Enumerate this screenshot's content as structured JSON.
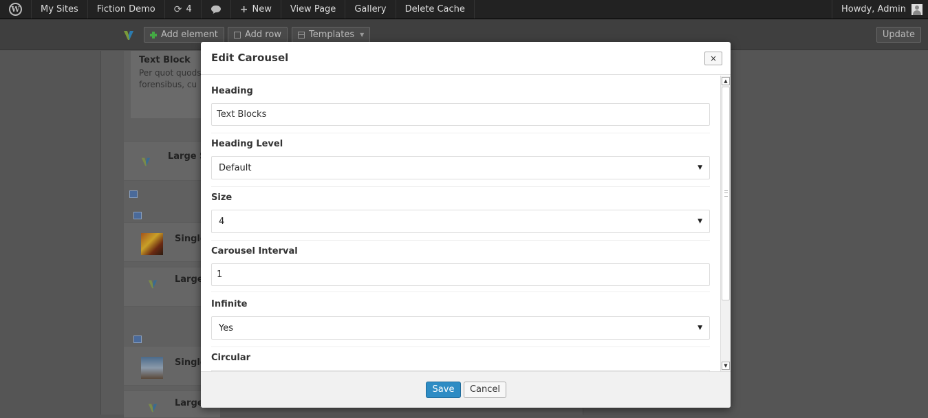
{
  "adminbar": {
    "my_sites": "My Sites",
    "site_name": "Fiction Demo",
    "updates_count": "4",
    "new_label": "New",
    "view_page": "View Page",
    "gallery": "Gallery",
    "delete_cache": "Delete Cache",
    "howdy": "Howdy, Admin"
  },
  "toolbar": {
    "add_element": "Add element",
    "add_row": "Add row",
    "templates": "Templates",
    "update": "Update"
  },
  "background": {
    "text_block_title": "Text Block",
    "text_block_body": "Per quot quods\nforensibus, cu",
    "large_1": "Large S",
    "single_1": "Single",
    "large_2": "Large",
    "single_2": "Single",
    "large_3": "Large"
  },
  "modal": {
    "title": "Edit Carousel",
    "close": "×",
    "fields": [
      {
        "label": "Heading",
        "type": "text",
        "value": "Text Blocks"
      },
      {
        "label": "Heading Level",
        "type": "select",
        "value": "Default"
      },
      {
        "label": "Size",
        "type": "select",
        "value": "4"
      },
      {
        "label": "Carousel Interval",
        "type": "text",
        "value": "1"
      },
      {
        "label": "Infinite",
        "type": "select",
        "value": "Yes"
      },
      {
        "label": "Circular",
        "type": "select",
        "value": ""
      }
    ],
    "save": "Save",
    "cancel": "Cancel"
  },
  "colors": {
    "adminbar_bg": "#222222",
    "primary_button": "#2e8cc4",
    "overlay": "#555555"
  },
  "icons": {
    "wp_logo": "wordpress-logo-icon",
    "updates": "refresh-icon",
    "comments": "speech-bubble-icon",
    "new": "plus-icon",
    "user": "avatar-icon"
  }
}
